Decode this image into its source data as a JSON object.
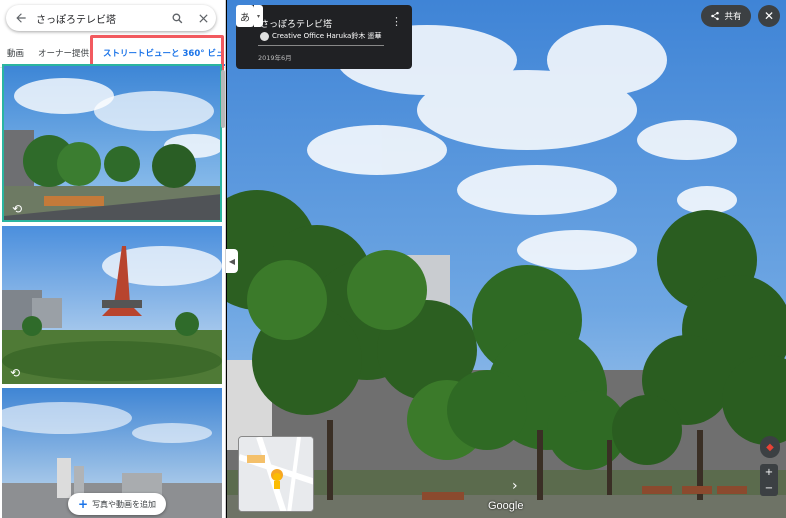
{
  "search": {
    "query": "さっぽろテレビ塔"
  },
  "tabs": [
    {
      "label": "動画"
    },
    {
      "label": "オーナー提供"
    },
    {
      "label": "ストリートビューと 360° ビュー"
    }
  ],
  "left_panel": {
    "add_button_label": "写真や動画を追加"
  },
  "info_card": {
    "title": "さっぽろテレビ塔",
    "author": "Creative Office Haruka鈴木 遥華",
    "date": "2019年6月"
  },
  "language_button": {
    "label": "あ"
  },
  "share": {
    "label": "共有"
  },
  "branding": {
    "label": "Google"
  },
  "colors": {
    "accent": "#1a73e8",
    "highlight": "#f25a5f",
    "sky": "#4a8bd8",
    "selected_border": "#2bb5a0"
  },
  "icons": [
    "back-arrow-icon",
    "search-icon",
    "close-icon",
    "rotate-360-icon",
    "more-vert-icon",
    "share-icon",
    "compass-icon",
    "zoom-in-icon",
    "zoom-out-icon",
    "pegman-icon",
    "chevron-left-icon",
    "navigation-arrow-icon",
    "plus-icon"
  ]
}
